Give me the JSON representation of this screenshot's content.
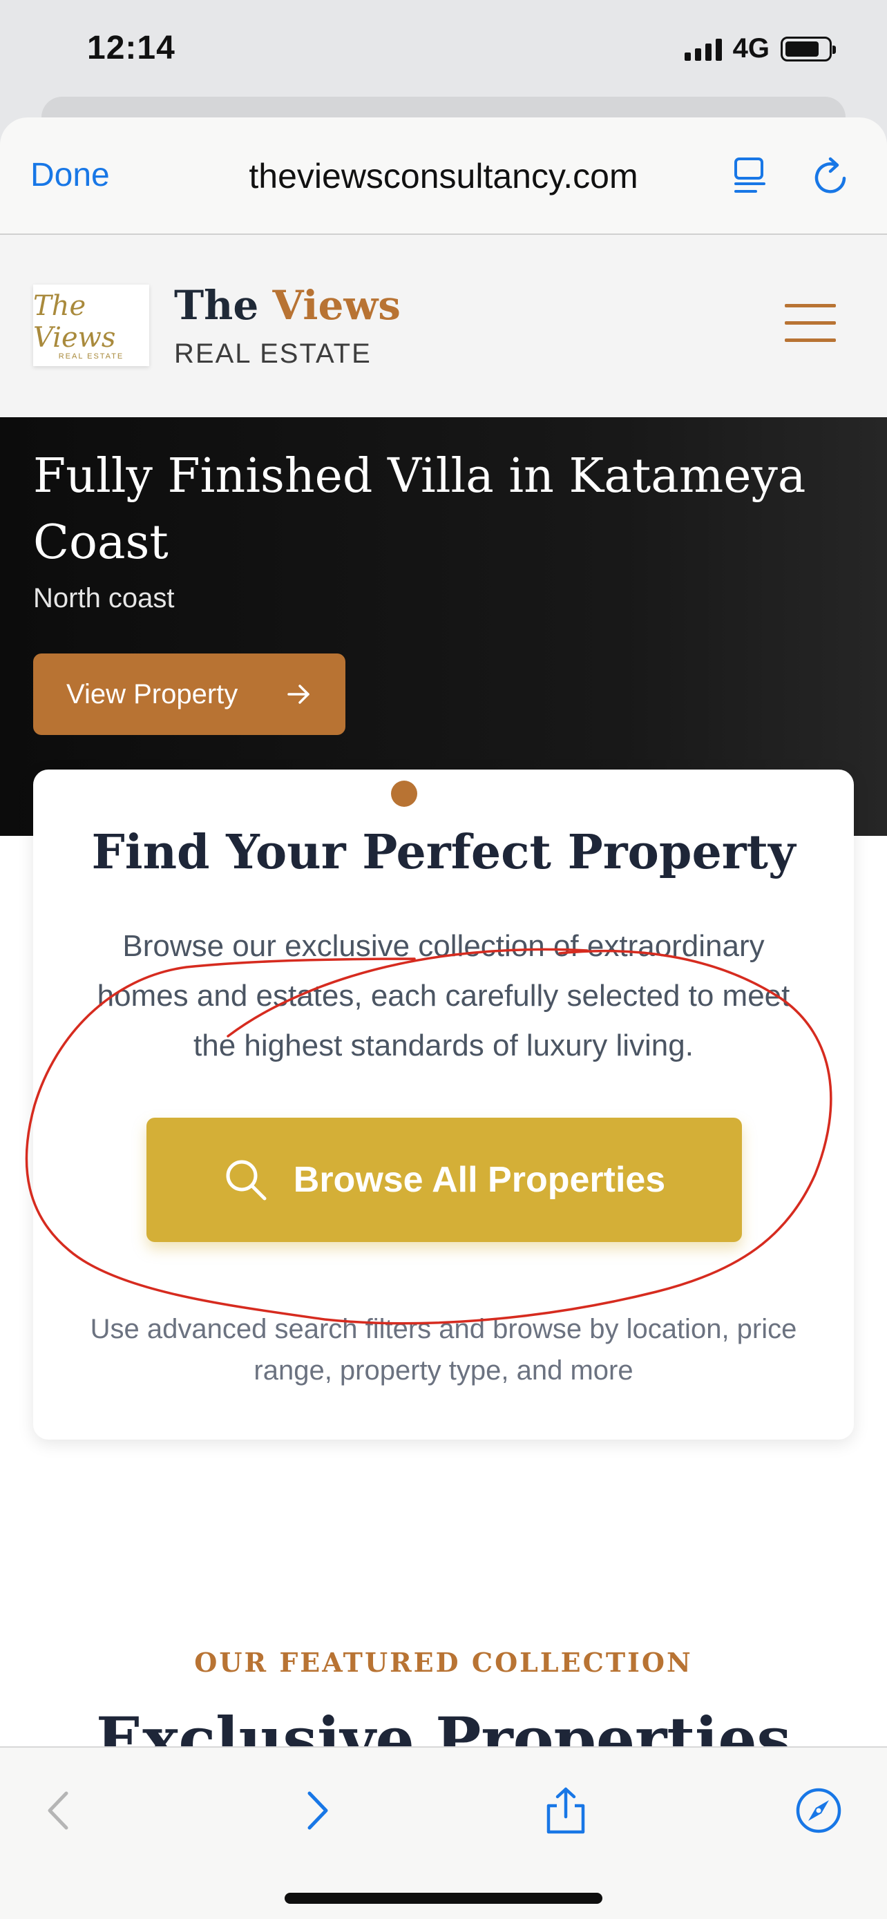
{
  "status_bar": {
    "time": "12:14",
    "network": "4G"
  },
  "browser": {
    "done_label": "Done",
    "url": "theviewsconsultancy.com"
  },
  "site_header": {
    "logo_script": "The Views",
    "logo_sub": "REAL ESTATE",
    "brand_name_part1": "The",
    "brand_name_part2": "Views",
    "brand_subtitle": "REAL ESTATE"
  },
  "hero": {
    "title": "Fully Finished Villa in Katameya Coast",
    "location": "North coast",
    "cta_label": "View Property"
  },
  "search_card": {
    "title": "Find Your Perfect Property",
    "description": "Browse our exclusive collection of extraordinary homes and estates, each carefully selected to meet the highest standards of luxury living.",
    "button_label": "Browse All Properties",
    "note": "Use advanced search filters and browse by location, price range, property type, and more"
  },
  "featured": {
    "kicker": "OUR FEATURED COLLECTION",
    "heading": "Exclusive Properties"
  },
  "icons": {
    "reader": "reader-icon",
    "reload": "reload-icon",
    "menu": "hamburger-menu-icon",
    "arrow": "arrow-right-icon",
    "search": "search-icon",
    "back": "chevron-left-icon",
    "forward": "chevron-right-icon",
    "share": "share-icon",
    "safari": "compass-icon"
  },
  "colors": {
    "accent_copper": "#b87333",
    "gold_button": "#d4af37",
    "ios_blue": "#1877e6",
    "annotation_red": "#d62b1f",
    "hero_bg": "#111111"
  }
}
